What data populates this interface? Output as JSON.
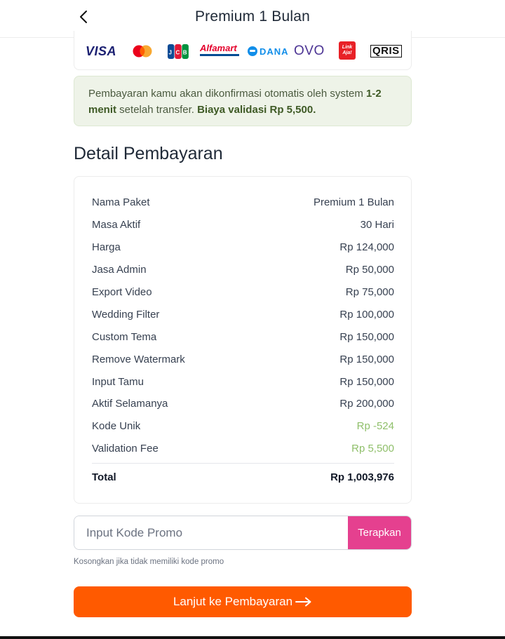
{
  "header": {
    "title": "Premium 1 Bulan",
    "back_icon": "chevron-left-icon"
  },
  "payment_logos": [
    {
      "name": "visa-logo",
      "text": "VISA",
      "color": "#1a1f71"
    },
    {
      "name": "mastercard-logo",
      "colors": [
        "#eb001b",
        "#f79e1b"
      ]
    },
    {
      "name": "jcb-logo",
      "text": "JCB"
    },
    {
      "name": "alfamart-logo",
      "text": "Alfamart",
      "color": "#e4002b"
    },
    {
      "name": "dana-logo",
      "text": "DANA",
      "color": "#118ee9"
    },
    {
      "name": "ovo-logo",
      "text": "OVO",
      "color": "#4c3494"
    },
    {
      "name": "linkaja-logo",
      "text": "Link Aja!",
      "color": "#e82127"
    },
    {
      "name": "qris-logo",
      "text": "QRIS"
    }
  ],
  "notice": {
    "text_1": "Pembayaran kamu akan dikonfirmasi otomatis oleh system ",
    "bold_1": "1-2 menit",
    "text_2": " setelah transfer. ",
    "bold_2": "Biaya validasi Rp 5,500."
  },
  "detail": {
    "title": "Detail Pembayaran",
    "rows": [
      {
        "label": "Nama Paket",
        "value": "Premium 1 Bulan"
      },
      {
        "label": "Masa Aktif",
        "value": "30 Hari"
      },
      {
        "label": "Harga",
        "value": "Rp 124,000"
      },
      {
        "label": "Jasa Admin",
        "value": "Rp 50,000"
      },
      {
        "label": "Export Video",
        "value": "Rp 75,000"
      },
      {
        "label": "Wedding Filter",
        "value": "Rp 100,000"
      },
      {
        "label": "Custom Tema",
        "value": "Rp 150,000"
      },
      {
        "label": "Remove Watermark",
        "value": "Rp 150,000"
      },
      {
        "label": "Input Tamu",
        "value": "Rp 150,000"
      },
      {
        "label": "Aktif Selamanya",
        "value": "Rp 200,000"
      },
      {
        "label": "Kode Unik",
        "value": "Rp -524"
      },
      {
        "label": "Validation Fee",
        "value": "Rp 5,500"
      }
    ],
    "total": {
      "label": "Total",
      "value": "Rp 1,003,976"
    }
  },
  "promo": {
    "placeholder": "Input Kode Promo",
    "value": "",
    "apply_label": "Terapkan",
    "hint": "Kosongkan jika tidak memiliki kode promo"
  },
  "cta": {
    "label": "Lanjut ke Pembayaran",
    "icon": "arrow-right-icon"
  },
  "colors": {
    "accent": "#ff5a00",
    "promo_button": "#e5408f",
    "positive": "#8fbf6a"
  }
}
